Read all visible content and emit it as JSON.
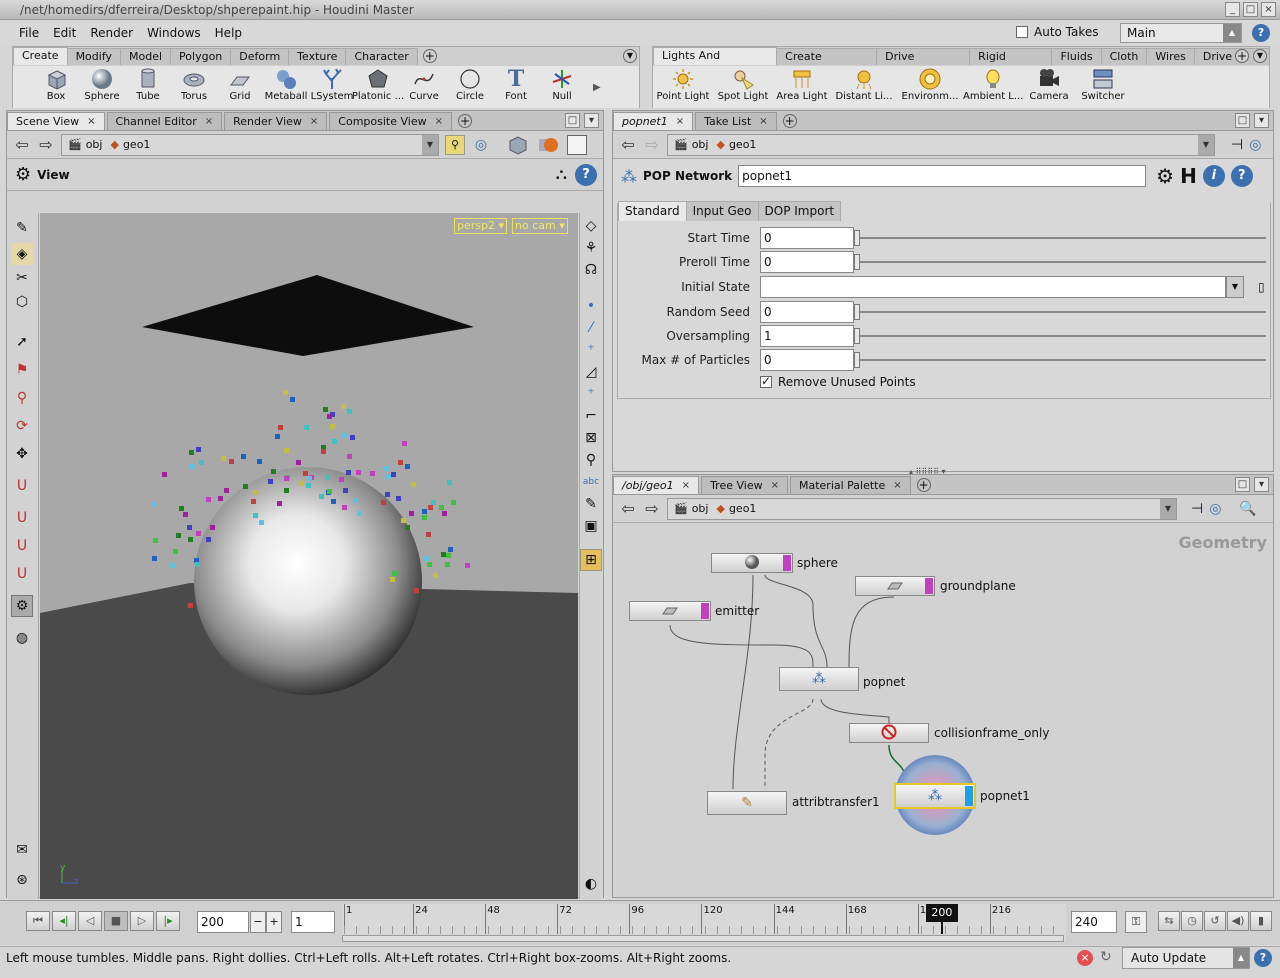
{
  "window": {
    "title": "/net/homedirs/dferreira/Desktop/shperepaint.hip - Houdini Master"
  },
  "menu": {
    "items": [
      "File",
      "Edit",
      "Render",
      "Windows",
      "Help"
    ],
    "auto_takes_label": "Auto Takes",
    "auto_takes_checked": false,
    "take_value": "Main"
  },
  "shelf_left": {
    "tabs": [
      "Create",
      "Modify",
      "Model",
      "Polygon",
      "Deform",
      "Texture",
      "Character"
    ],
    "active_tab": "Create",
    "tools": [
      {
        "label": "Box",
        "icon": "box-icon"
      },
      {
        "label": "Sphere",
        "icon": "sphere-icon"
      },
      {
        "label": "Tube",
        "icon": "tube-icon"
      },
      {
        "label": "Torus",
        "icon": "torus-icon"
      },
      {
        "label": "Grid",
        "icon": "grid-icon"
      },
      {
        "label": "Metaball",
        "icon": "metaball-icon"
      },
      {
        "label": "LSystem",
        "icon": "lsystem-icon"
      },
      {
        "label": "Platonic ...",
        "icon": "platonic-icon"
      },
      {
        "label": "Curve",
        "icon": "curve-icon"
      },
      {
        "label": "Circle",
        "icon": "circle-icon"
      },
      {
        "label": "Font",
        "icon": "font-icon"
      },
      {
        "label": "Null",
        "icon": "null-icon"
      }
    ]
  },
  "shelf_right": {
    "tabs": [
      "Lights And Cameras",
      "Create Particles",
      "Drive Particles",
      "Rigid Bodies",
      "Fluids",
      "Cloth",
      "Wires",
      "Drive Simu"
    ],
    "active_tab": "Lights And Cameras",
    "tools": [
      {
        "label": "Point Light",
        "icon": "point-light-icon"
      },
      {
        "label": "Spot Light",
        "icon": "spot-light-icon"
      },
      {
        "label": "Area Light",
        "icon": "area-light-icon"
      },
      {
        "label": "Distant Li...",
        "icon": "distant-light-icon"
      },
      {
        "label": "Environm...",
        "icon": "environment-light-icon"
      },
      {
        "label": "Ambient L...",
        "icon": "ambient-light-icon"
      },
      {
        "label": "Camera",
        "icon": "camera-icon"
      },
      {
        "label": "Switcher",
        "icon": "switcher-icon"
      }
    ]
  },
  "scene_pane": {
    "tabs": [
      "Scene View",
      "Channel Editor",
      "Render View",
      "Composite View"
    ],
    "active_tab": "Scene View",
    "path": [
      "obj",
      "geo1"
    ],
    "view_label": "View",
    "persp_label": "persp2",
    "cam_label": "no cam",
    "axis_y": "y",
    "axis_z": "z"
  },
  "parm_pane": {
    "tabs": [
      "popnet1",
      "Take List"
    ],
    "active_tab": "popnet1",
    "path": [
      "obj",
      "geo1"
    ],
    "node_type": "POP Network",
    "node_name": "popnet1",
    "subtabs": [
      "Standard",
      "Input Geo",
      "DOP Import"
    ],
    "active_subtab": "Standard",
    "parms": [
      {
        "label": "Start Time",
        "value": "0",
        "slider": true
      },
      {
        "label": "Preroll Time",
        "value": "0",
        "slider": true
      },
      {
        "label": "Initial State",
        "value": "",
        "slider": false
      },
      {
        "label": "Random Seed",
        "value": "0",
        "slider": true
      },
      {
        "label": "Oversampling",
        "value": "1",
        "slider": true
      },
      {
        "label": "Max # of Particles",
        "value": "0",
        "slider": true
      }
    ],
    "remove_unused_label": "Remove Unused Points",
    "remove_unused_checked": true
  },
  "network_pane": {
    "tabs": [
      "/obj/geo1",
      "Tree View",
      "Material Palette"
    ],
    "active_tab": "/obj/geo1",
    "path": [
      "obj",
      "geo1"
    ],
    "context_label": "Geometry",
    "nodes": [
      {
        "name": "sphere",
        "icon": "sphere-node-icon"
      },
      {
        "name": "groundplane",
        "icon": "grid-node-icon"
      },
      {
        "name": "emitter",
        "icon": "grid-node-icon"
      },
      {
        "name": "popnet",
        "icon": "pop-network-icon"
      },
      {
        "name": "collisionframe_only",
        "icon": "no-entry-icon"
      },
      {
        "name": "attribtransfer1",
        "icon": "attribtransfer-icon"
      },
      {
        "name": "popnet1",
        "icon": "pop-network-icon"
      }
    ]
  },
  "timeline": {
    "current_frame": "200",
    "step": "1",
    "ticks": [
      "1",
      "24",
      "48",
      "72",
      "96",
      "120",
      "144",
      "168",
      "192",
      "216"
    ],
    "marker": "200",
    "end_frame": "240",
    "range_start": 1,
    "range_end": 240,
    "current": 200
  },
  "status": {
    "message": "Left mouse tumbles. Middle pans. Right dollies. Ctrl+Left rolls. Alt+Left rotates. Ctrl+Right box-zooms. Alt+Right zooms.",
    "update_mode": "Auto Update"
  }
}
